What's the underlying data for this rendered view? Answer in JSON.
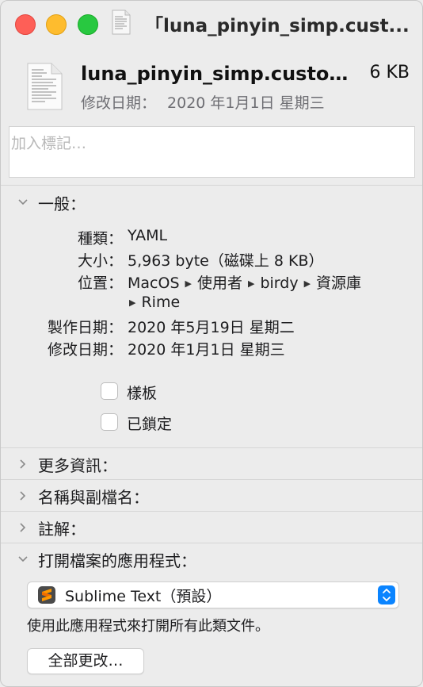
{
  "window": {
    "title": "「luna_pinyin_simp.cust...",
    "colors": {
      "close": "#fe5f57",
      "minimize": "#febc2e",
      "zoom": "#28c840"
    }
  },
  "header": {
    "file_name": "luna_pinyin_simp.custo...",
    "file_size": "6 KB",
    "modified_label": "修改日期：",
    "modified_value": "2020 年1月1日 星期三"
  },
  "tags": {
    "placeholder": "加入標記…"
  },
  "sections": {
    "general": "一般：",
    "more_info": "更多資訊：",
    "name_ext": "名稱與副檔名：",
    "comments": "註解：",
    "open_with": "打開檔案的應用程式："
  },
  "general": {
    "kind_label": "種類：",
    "kind_value": "YAML",
    "size_label": "大小：",
    "size_value": "5,963 byte（磁碟上 8 KB）",
    "where_label": "位置：",
    "path": [
      "MacOS",
      "使用者",
      "birdy",
      "資源庫",
      "Rime"
    ],
    "created_label": "製作日期：",
    "created_value": "2020 年5月19日 星期二",
    "modified_label": "修改日期：",
    "modified_value": "2020 年1月1日 星期三",
    "stationery_label": "樣板",
    "locked_label": "已鎖定",
    "stationery_checked": false,
    "locked_checked": false
  },
  "open_with": {
    "app_name": "Sublime Text（預設）",
    "app_icon": "sublime-text-icon",
    "description": "使用此應用程式來打開所有此類文件。",
    "change_all_label": "全部更改…",
    "accent": "#0a84ff"
  }
}
